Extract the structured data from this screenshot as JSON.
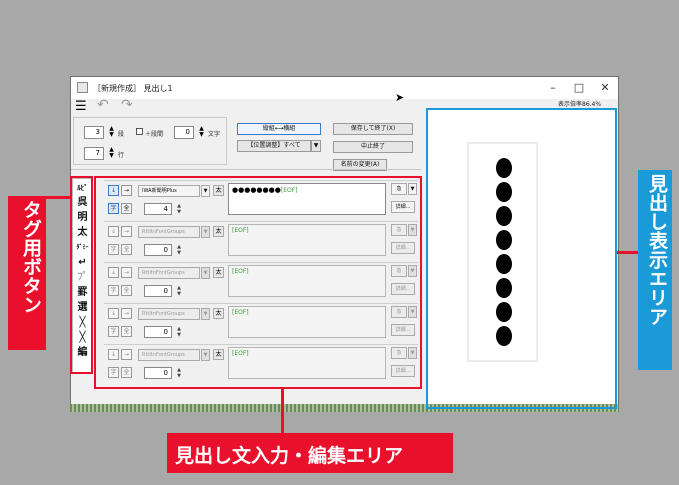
{
  "window": {
    "title": "［新規作成］ 見出し1",
    "minimize": "–",
    "maximize": "□",
    "close": "✕",
    "zoom_label": "表示倍率86.4%"
  },
  "toolbar": {
    "menu_icon": "☰",
    "undo_icon": "↶",
    "redo_icon": "↷"
  },
  "settings": {
    "dan_value": "3",
    "dan_label": "段",
    "danma_label": "＋段間",
    "moji_value": "0",
    "moji_label": "文字",
    "gyo_value": "7",
    "gyo_label": "行"
  },
  "actions": {
    "orientation": "縦組⟷横組",
    "position_adjust": "【位置調整】すべて",
    "save_exit": "保存して終了(X)",
    "cancel_exit": "中止終了",
    "rename": "名前の変更(A)"
  },
  "tag_buttons": [
    "ﾙﾋﾞ",
    "呉",
    "明",
    "太",
    "ﾀﾞﾐｰ",
    "↵",
    "ﾌﾟ",
    "罫",
    "選",
    "╳",
    "╳",
    "編"
  ],
  "rows": [
    {
      "font": "IWA新聞明Plus",
      "size": "4",
      "text": "●●●●●●●●",
      "eof": "[EOF]",
      "kb": "急",
      "detail": "詳細..."
    },
    {
      "font": "RttItnFontGroups",
      "size": "0",
      "text": "",
      "eof": "[EOF]",
      "kb": "急",
      "detail": "詳細..."
    },
    {
      "font": "RttItnFontGroups",
      "size": "0",
      "text": "",
      "eof": "[EOF]",
      "kb": "急",
      "detail": "詳細..."
    },
    {
      "font": "RttItnFontGroups",
      "size": "0",
      "text": "",
      "eof": "[EOF]",
      "kb": "急",
      "detail": "詳細..."
    },
    {
      "font": "RttItnFontGroups",
      "size": "0",
      "text": "",
      "eof": "[EOF]",
      "kb": "急",
      "detail": "詳細..."
    }
  ],
  "row_controls": {
    "down": "↓",
    "right": "→",
    "ji": "字",
    "zen": "全",
    "tai": "太",
    "dropdown": "▼"
  },
  "annotations": {
    "tag_buttons": "タグ用ボタン",
    "edit_area": "見出し文入力・編集エリア",
    "preview_area": "見出し表示エリア"
  },
  "colors": {
    "annotation_red": "#e8102a",
    "annotation_blue": "#1a9ad6",
    "eof_green": "#3a9a3a"
  }
}
